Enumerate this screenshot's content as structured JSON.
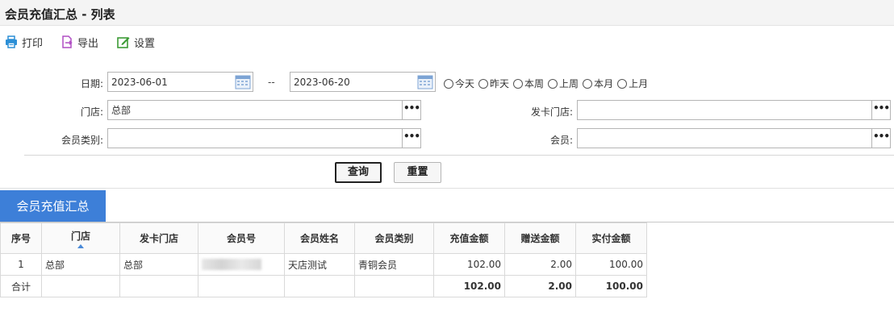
{
  "page": {
    "title": "会员充值汇总 - 列表"
  },
  "toolbar": {
    "print": {
      "label": "打印",
      "icon": "printer-icon",
      "color": "#2c8fd6"
    },
    "export": {
      "label": "导出",
      "icon": "export-icon",
      "color": "#b04fc4"
    },
    "settings": {
      "label": "设置",
      "icon": "edit-settings-icon",
      "color": "#3c9b35"
    }
  },
  "filters": {
    "date": {
      "label": "日期:",
      "from": "2023-06-01",
      "separator": "--",
      "to": "2023-06-20"
    },
    "quick_ranges": [
      "今天",
      "昨天",
      "本周",
      "上周",
      "本月",
      "上月"
    ],
    "store": {
      "label": "门店:",
      "value": "总部"
    },
    "card_store": {
      "label": "发卡门店:",
      "value": ""
    },
    "member_type": {
      "label": "会员类别:",
      "value": ""
    },
    "member": {
      "label": "会员:",
      "value": ""
    },
    "lookup_button": "•••"
  },
  "actions": {
    "query": "查询",
    "reset": "重置"
  },
  "tab": {
    "label": "会员充值汇总",
    "color": "#3d7fd8"
  },
  "table": {
    "columns": [
      "序号",
      "门店",
      "发卡门店",
      "会员号",
      "会员姓名",
      "会员类别",
      "充值金额",
      "赠送金额",
      "实付金额"
    ],
    "rows": [
      {
        "index": "1",
        "store": "总部",
        "card_store": "总部",
        "member_no": "",
        "member_name": "天店测试",
        "member_type": "青铜会员",
        "recharge": "102.00",
        "bonus": "2.00",
        "paid": "100.00"
      }
    ],
    "total": {
      "label": "合计",
      "recharge": "102.00",
      "bonus": "2.00",
      "paid": "100.00"
    }
  }
}
